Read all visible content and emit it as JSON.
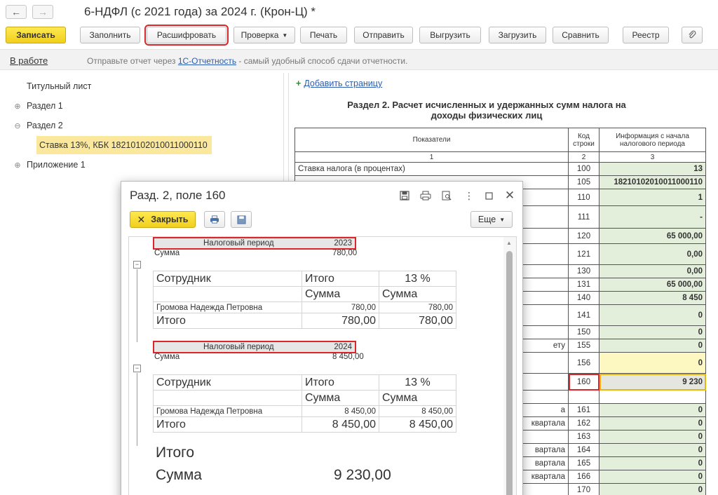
{
  "window": {
    "title": "6-НДФЛ (с 2021 года) за 2024 г. (Крон-Ц) *",
    "back_icon": "arrow-left",
    "forward_icon": "arrow-right"
  },
  "toolbar": {
    "record": "Записать",
    "fill": "Заполнить",
    "decode": "Расшифровать",
    "check": "Проверка",
    "print": "Печать",
    "send": "Отправить",
    "export": "Выгрузить",
    "import": "Загрузить",
    "compare": "Сравнить",
    "registry": "Реестр",
    "attach_icon": "paperclip"
  },
  "status": {
    "state": "В работе",
    "msg_before": "Отправьте отчет через ",
    "msg_link": "1С-Отчетность",
    "msg_after": " - самый удобный способ сдачи отчетности."
  },
  "tree": {
    "items": [
      {
        "label": "Титульный лист",
        "exp": ""
      },
      {
        "label": "Раздел 1",
        "exp": "⊕"
      },
      {
        "label": "Раздел 2",
        "exp": "⊖"
      },
      {
        "label": "Ставка 13%, КБК 18210102010011000110",
        "exp": ""
      },
      {
        "label": "Приложение 1",
        "exp": "⊕"
      }
    ]
  },
  "report": {
    "add_page": "Добавить страницу",
    "title": "Раздел 2. Расчет исчисленных и удержанных сумм налога на доходы физических лиц",
    "col_indicators": "Показатели",
    "col_code": "Код строки",
    "col_info": "Информация с начала налогового периода",
    "idx1": "1",
    "idx2": "2",
    "idx3": "3",
    "rows": [
      {
        "label": "Ставка налога (в процентах)",
        "code": "100",
        "value": "13"
      },
      {
        "label": "",
        "code": "105",
        "value": "18210102010011000110"
      },
      {
        "label": "",
        "code": "110",
        "value": "1"
      },
      {
        "label": "",
        "code": "111",
        "value": "-"
      },
      {
        "label": "",
        "code": "120",
        "value": "65 000,00"
      },
      {
        "label": "",
        "code": "121",
        "value": "0,00"
      },
      {
        "label": "",
        "code": "130",
        "value": "0,00"
      },
      {
        "label": "",
        "code": "131",
        "value": "65 000,00"
      },
      {
        "label": "",
        "code": "140",
        "value": "8 450"
      },
      {
        "label": "",
        "code": "141",
        "value": "0"
      },
      {
        "label": "",
        "code": "150",
        "value": "0"
      },
      {
        "label": "ету",
        "code": "155",
        "value": "0"
      },
      {
        "label": "",
        "code": "156",
        "value": "0"
      },
      {
        "label": "",
        "code": "160",
        "value": "9 230"
      },
      {
        "label": "",
        "code": "",
        "value": ""
      },
      {
        "label": "а",
        "code": "161",
        "value": "0"
      },
      {
        "label": "квартала",
        "code": "162",
        "value": "0"
      },
      {
        "label": "",
        "code": "163",
        "value": "0"
      },
      {
        "label": "вартала",
        "code": "164",
        "value": "0"
      },
      {
        "label": "вартала",
        "code": "165",
        "value": "0"
      },
      {
        "label": "квартала",
        "code": "166",
        "value": "0"
      },
      {
        "label": "",
        "code": "170",
        "value": "0"
      }
    ]
  },
  "popup": {
    "title": "Разд. 2, поле 160",
    "close": "Закрыть",
    "more": "Еще",
    "periods": [
      {
        "period_label": "Налоговый период",
        "year": "2023",
        "sum_label": "Сумма",
        "sum_value": "780,00",
        "col_employee": "Сотрудник",
        "col_total": "Итого",
        "col_rate": "13 %",
        "col_sum1": "Сумма",
        "col_sum2": "Сумма",
        "employee": "Громова Надежда Петровна",
        "emp_total": "780,00",
        "emp_rate": "780,00",
        "total_label": "Итого",
        "total_total": "780,00",
        "total_rate": "780,00"
      },
      {
        "period_label": "Налоговый период",
        "year": "2024",
        "sum_label": "Сумма",
        "sum_value": "8 450,00",
        "col_employee": "Сотрудник",
        "col_total": "Итого",
        "col_rate": "13 %",
        "col_sum1": "Сумма",
        "col_sum2": "Сумма",
        "employee": "Громова Надежда Петровна",
        "emp_total": "8 450,00",
        "emp_rate": "8 450,00",
        "total_label": "Итого",
        "total_total": "8 450,00",
        "total_rate": "8 450,00"
      }
    ],
    "grand_total_label": "Итого",
    "grand_sum_label": "Сумма",
    "grand_sum_value": "9 230,00"
  }
}
